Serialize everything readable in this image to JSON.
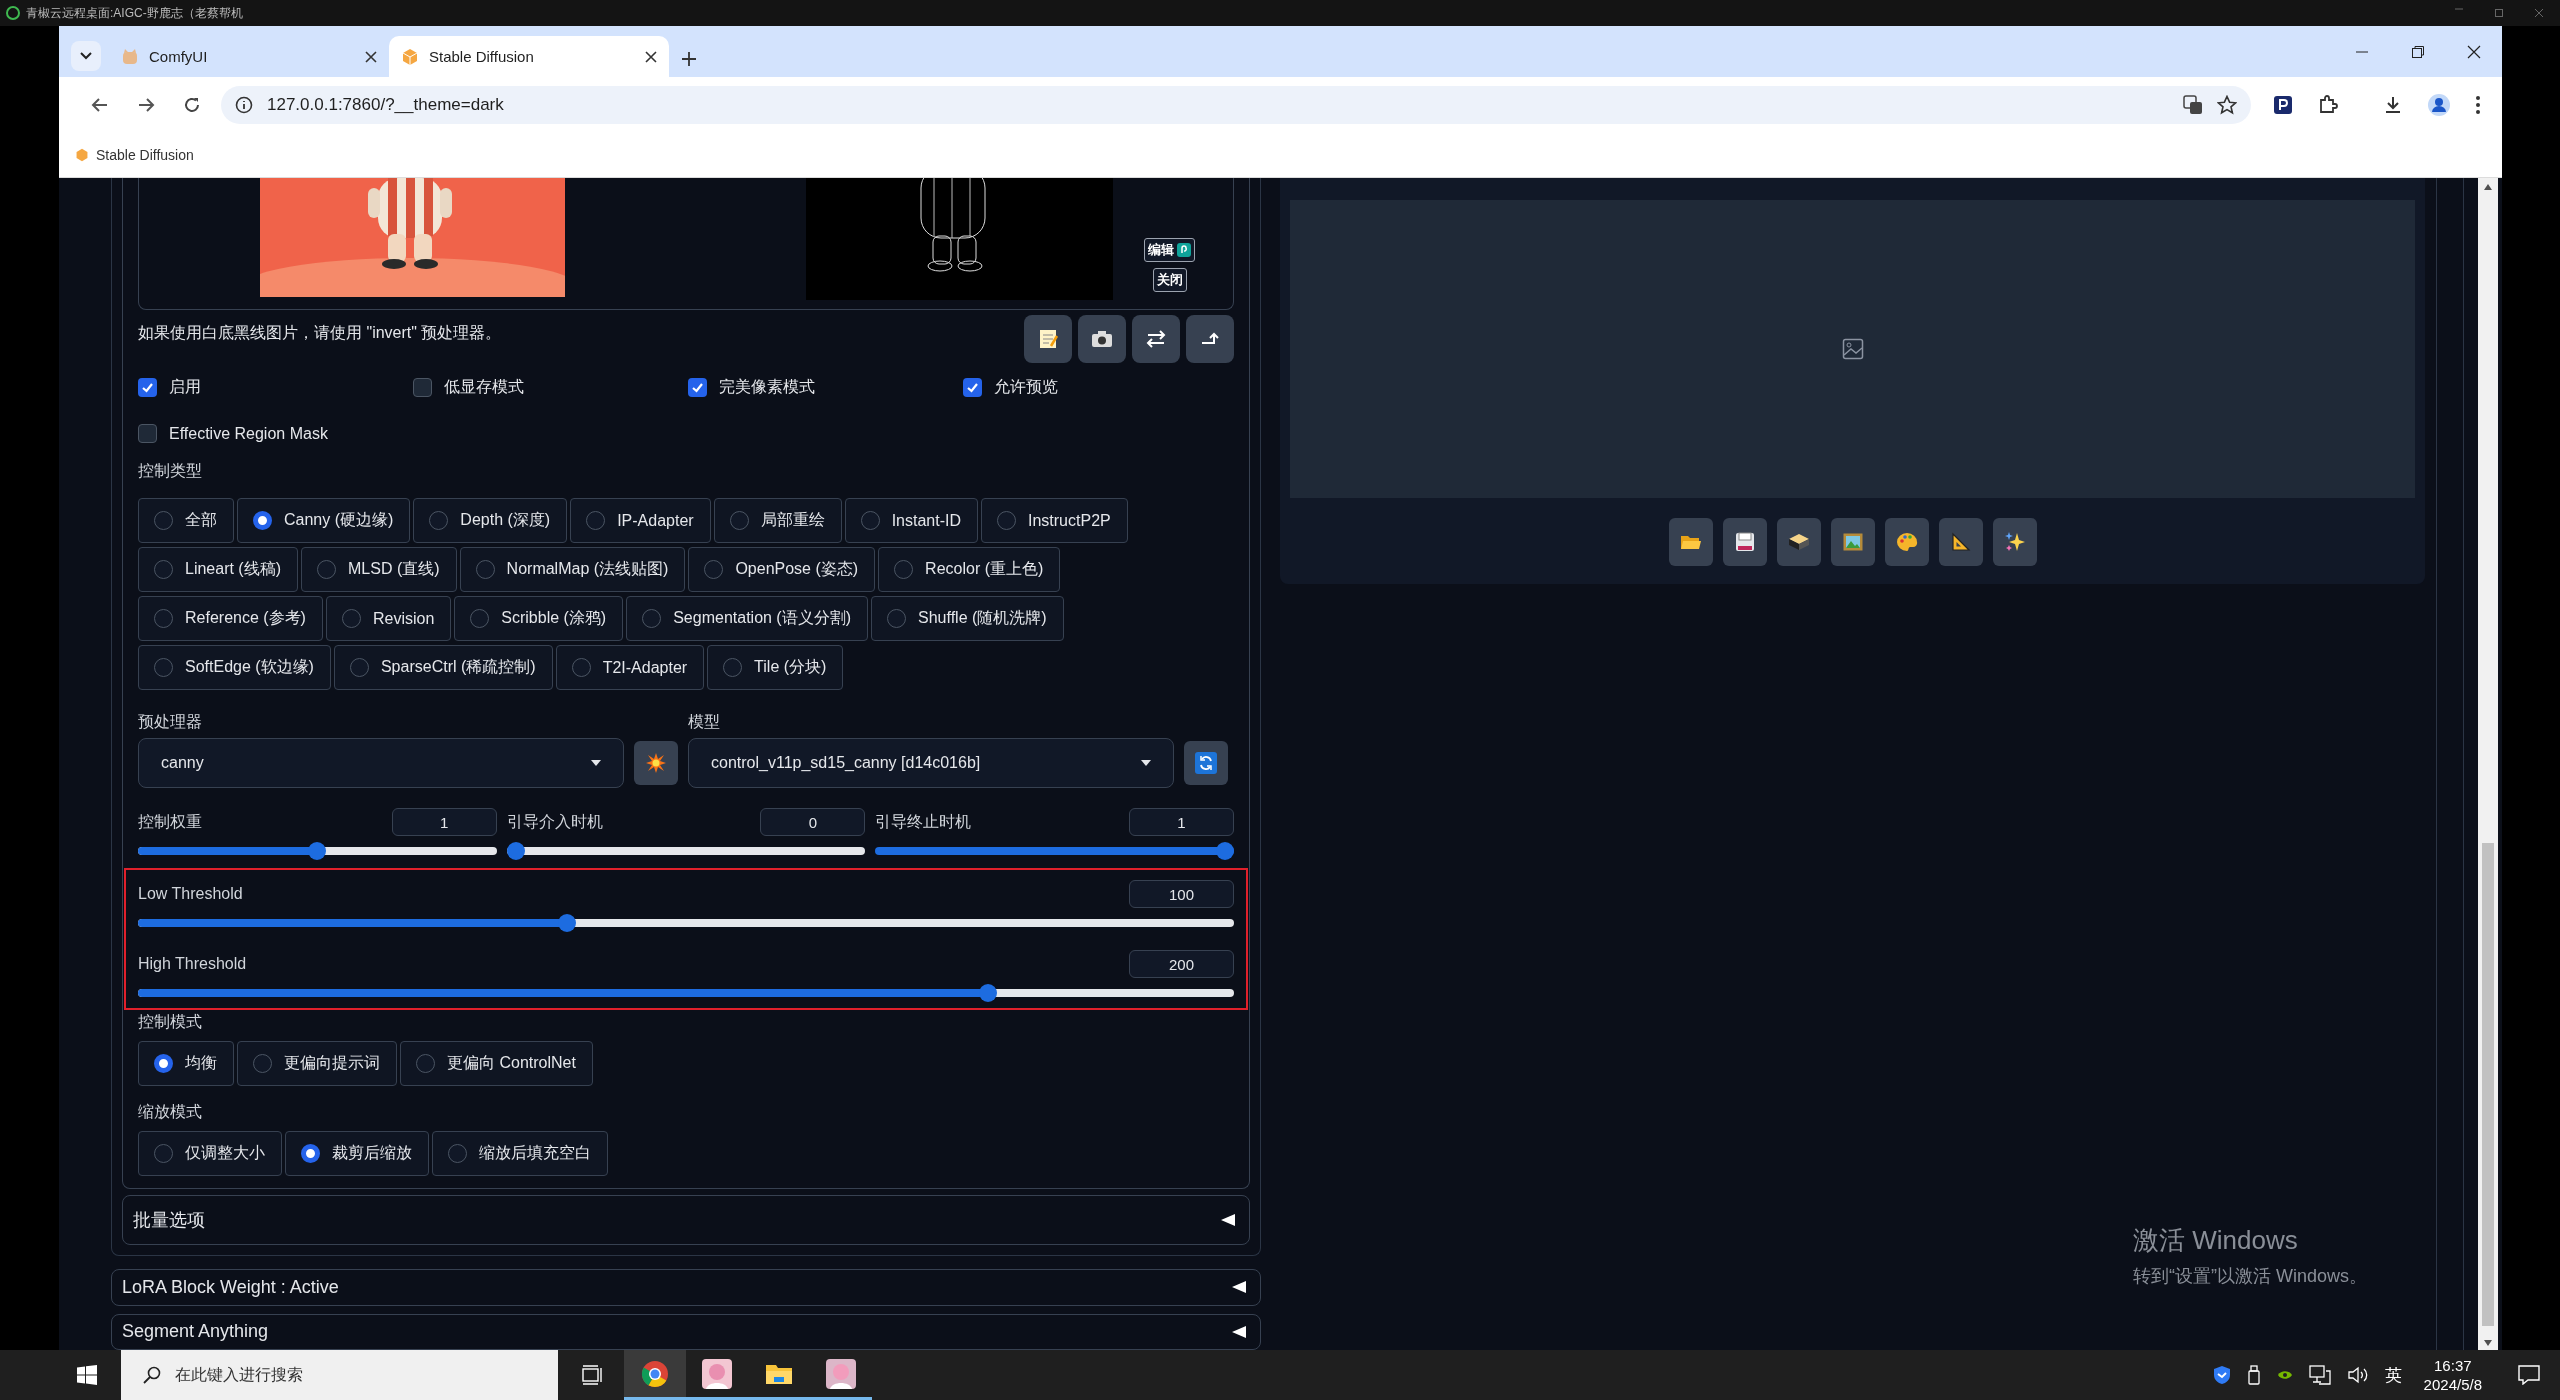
{
  "remote_desktop": {
    "title": "青椒云远程桌面:AIGC-野鹿志（老蔡帮机"
  },
  "browser": {
    "tabs": [
      {
        "title": "ComfyUI",
        "selected": false
      },
      {
        "title": "Stable Diffusion",
        "selected": true
      }
    ],
    "url": "127.0.0.1:7860/?__theme=dark",
    "bookmarks": [
      "Stable Diffusion"
    ]
  },
  "controlnet": {
    "image_buttons": [
      "编辑",
      "关闭"
    ],
    "hint": "如果使用白底黑线图片，请使用 \"invert\" 预处理器。",
    "checkboxes": [
      {
        "label": "启用",
        "checked": true
      },
      {
        "label": "低显存模式",
        "checked": false
      },
      {
        "label": "完美像素模式",
        "checked": true
      },
      {
        "label": "允许预览",
        "checked": true
      },
      {
        "label": "Effective Region Mask",
        "checked": false
      }
    ],
    "control_type": {
      "label": "控制类型",
      "options": [
        {
          "label": "全部",
          "selected": false
        },
        {
          "label": "Canny (硬边缘)",
          "selected": true
        },
        {
          "label": "Depth (深度)",
          "selected": false
        },
        {
          "label": "IP-Adapter",
          "selected": false
        },
        {
          "label": "局部重绘",
          "selected": false
        },
        {
          "label": "Instant-ID",
          "selected": false
        },
        {
          "label": "InstructP2P",
          "selected": false
        },
        {
          "label": "Lineart (线稿)",
          "selected": false
        },
        {
          "label": "MLSD (直线)",
          "selected": false
        },
        {
          "label": "NormalMap (法线贴图)",
          "selected": false
        },
        {
          "label": "OpenPose (姿态)",
          "selected": false
        },
        {
          "label": "Recolor (重上色)",
          "selected": false
        },
        {
          "label": "Reference (参考)",
          "selected": false
        },
        {
          "label": "Revision",
          "selected": false
        },
        {
          "label": "Scribble (涂鸦)",
          "selected": false
        },
        {
          "label": "Segmentation (语义分割)",
          "selected": false
        },
        {
          "label": "Shuffle (随机洗牌)",
          "selected": false
        },
        {
          "label": "SoftEdge (软边缘)",
          "selected": false
        },
        {
          "label": "SparseCtrl (稀疏控制)",
          "selected": false
        },
        {
          "label": "T2I-Adapter",
          "selected": false
        },
        {
          "label": "Tile (分块)",
          "selected": false
        }
      ]
    },
    "preprocessor": {
      "label": "预处理器",
      "value": "canny"
    },
    "model": {
      "label": "模型",
      "value": "control_v11p_sd15_canny [d14c016b]"
    },
    "sliders": [
      {
        "label": "控制权重",
        "value": "1",
        "level": 0.5
      },
      {
        "label": "引导介入时机",
        "value": "0",
        "level": 0
      },
      {
        "label": "引导终止时机",
        "value": "1",
        "level": 1
      }
    ],
    "threshold_sliders": [
      {
        "label": "Low Threshold",
        "value": "100",
        "level": 0.39
      },
      {
        "label": "High Threshold",
        "value": "200",
        "level": 0.78
      }
    ],
    "control_mode": {
      "label": "控制模式",
      "options": [
        {
          "label": "均衡",
          "selected": true
        },
        {
          "label": "更偏向提示词",
          "selected": false
        },
        {
          "label": "更偏向 ControlNet",
          "selected": false
        }
      ]
    },
    "resize_mode": {
      "label": "缩放模式",
      "options": [
        {
          "label": "仅调整大小",
          "selected": false
        },
        {
          "label": "裁剪后缩放",
          "selected": true
        },
        {
          "label": "缩放后填充空白",
          "selected": false
        }
      ]
    },
    "batch_options": {
      "title": "批量选项"
    }
  },
  "accordions": [
    {
      "title": "LoRA Block Weight : Active"
    },
    {
      "title": "Segment Anything"
    }
  ],
  "activation_notice": {
    "title": "激活 Windows",
    "text": "转到“设置”以激活 Windows。"
  },
  "taskbar": {
    "search_placeholder": "在此键入进行搜索",
    "input_method": "英",
    "time": "16:37",
    "date": "2024/5/8"
  }
}
